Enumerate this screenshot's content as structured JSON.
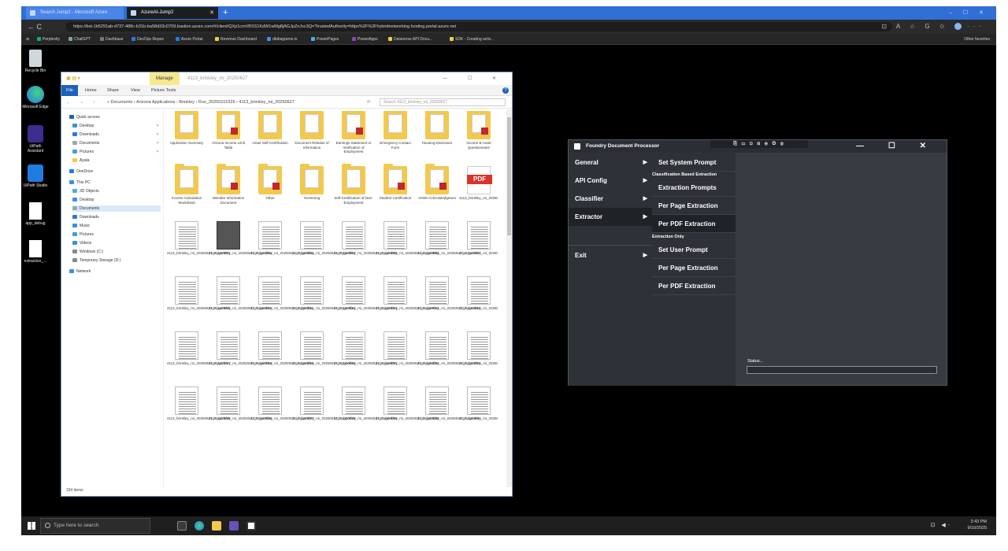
{
  "browser": {
    "tabs": [
      {
        "label": "Search Jump2 - Microsoft Azure"
      },
      {
        "label": "AzureAI-Jump2"
      }
    ],
    "new_tab": "+",
    "window_controls": "– ☐ ✕",
    "nav_buttons": "←  C",
    "url": "https://bst-1b5291ab-d737-488c-b31b-ba58d33c0709.bastion.azure.com/#/client/QXp1cmVBSS1KdW1wMg8jAGJpZnJvc3Q=?trustedAuthority=https%2F%2Fhybridnetworking.hosting.portal.azure.net",
    "actions": "⊡ A ☆ G ✩",
    "more": "···",
    "favorites": [
      "Perplexity",
      "ChatGPT",
      "Dashbase",
      "DevOps Repos",
      "Azure Portal",
      "Revenue Dashboard",
      "dbdiagrams.io",
      "PowerPages",
      "PowerApps",
      "Dataverse API Docu...",
      "SDK - Creating activ..."
    ],
    "other_favorites": "Other favorites"
  },
  "desktop": {
    "icons": [
      {
        "label": "Recycle Bin"
      },
      {
        "label": "Microsoft Edge"
      },
      {
        "label": "UiPath Assistant"
      },
      {
        "label": "UiPath Studio"
      },
      {
        "label": "app_debug"
      },
      {
        "label": "extraction_..."
      }
    ]
  },
  "explorer": {
    "title_manage": "Manage",
    "title_path": "4113_brinkley_mi_20250627",
    "window_controls": "—  ☐  ✕",
    "ribbon": [
      "File",
      "Home",
      "Share",
      "View",
      "Picture Tools"
    ],
    "help": "?",
    "nav_arrows": "← → ↑",
    "breadcrumb": "« Documents › Arizona Applications › Brinkley › Run_20250101526 › 4113_brinkley_mi_20250627",
    "refresh": "⟳",
    "search_placeholder": "Search 4113_brinkley_mi_20250627",
    "nav_items": [
      {
        "label": "Quick access",
        "color": "#1b63b8"
      },
      {
        "label": "Desktop",
        "color": "#3d8fe0"
      },
      {
        "label": "Downloads",
        "color": "#2a7ad8"
      },
      {
        "label": "Documents",
        "color": "#9aa"
      },
      {
        "label": "Pictures",
        "color": "#4a9ad8"
      },
      {
        "label": "Ayala",
        "color": "#f2c94c"
      },
      {
        "label": "OneDrive",
        "color": "#1f7de0"
      },
      {
        "label": "This PC",
        "color": "#3d8fe0"
      },
      {
        "label": "3D Objects",
        "color": "#4ab0e0"
      },
      {
        "label": "Desktop",
        "color": "#3d8fe0"
      },
      {
        "label": "Documents",
        "color": "#9aa"
      },
      {
        "label": "Downloads",
        "color": "#2a7ad8"
      },
      {
        "label": "Music",
        "color": "#3d8fe0"
      },
      {
        "label": "Pictures",
        "color": "#4a9ad8"
      },
      {
        "label": "Videos",
        "color": "#3d8fe0"
      },
      {
        "label": "Windows (C:)",
        "color": "#888"
      },
      {
        "label": "Temporary Storage (D:)",
        "color": "#888"
      },
      {
        "label": "Network",
        "color": "#3d8fe0"
      }
    ],
    "pin_mark": "✶",
    "folders": [
      "Application Summary",
      "Arizona Income Limit Table",
      "Asset Self-Certification",
      "Document Release of Information",
      "Earnings Statement or Verification of Employment",
      "Emergency Contact Form",
      "Housing Disclosure",
      "Income & Asset Questionnaire",
      "Income Calculation Worksheet",
      "Member Information Document",
      "Other",
      "Screening",
      "Self-Certification of Non-Employment",
      "Student Certification",
      "VAWA Acknowledgment"
    ],
    "pdf_label": "PDF",
    "pdf_file": "4113_brinkley_mi_20250627",
    "pages": [
      "4113_brinkley_mi_20250627_Page0001",
      "4113_brinkley_mi_20250627_Page0002",
      "4113_brinkley_mi_20250627_Page0003",
      "4113_brinkley_mi_20250627_Page0004",
      "4113_brinkley_mi_20250627_Page0005",
      "4113_brinkley_mi_20250627_Page0006",
      "4113_brinkley_mi_20250627_Page0007",
      "4113_brinkley_mi_20250627_Page0008",
      "4113_brinkley_mi_20250627_Page0009",
      "4113_brinkley_mi_20250627_Page0010",
      "4113_brinkley_mi_20250627_Page0011",
      "4113_brinkley_mi_20250627_Page0012",
      "4113_brinkley_mi_20250627_Page0013",
      "4113_brinkley_mi_20250627_Page0014",
      "4113_brinkley_mi_20250627_Page0015",
      "4113_brinkley_mi_20250627_Page0016",
      "4113_brinkley_mi_20250627_Page0017",
      "4113_brinkley_mi_20250627_Page0018",
      "4113_brinkley_mi_20250627_Page0019",
      "4113_brinkley_mi_20250627_Page0020",
      "4113_brinkley_mi_20250627_Page0021",
      "4113_brinkley_mi_20250627_Page0022",
      "4113_brinkley_mi_20250627_Page0023",
      "4113_brinkley_mi_20250627_Page0024",
      "4113_brinkley_mi_20250627_Page0025",
      "4113_brinkley_mi_20250627_Page0026",
      "4113_brinkley_mi_20250627_Page0027",
      "4113_brinkley_mi_20250627_Page0028",
      "4113_brinkley_mi_20250627_Page0029",
      "4113_brinkley_mi_20250627_Page0030",
      "4113_brinkley_mi_20250627_Page0031",
      "4113_brinkley_mi_20250627_Page0032"
    ],
    "status": "154 items"
  },
  "foundry": {
    "title": "Foundry Document Processor",
    "toolbar": "⎘ ▭ ⊡ ⊟ ⊕ ◎ ⊗",
    "window_controls": "— ☐ ✕",
    "menu": [
      {
        "label": "General"
      },
      {
        "label": "API Config"
      },
      {
        "label": "Classifier"
      },
      {
        "label": "Extractor"
      },
      {
        "label": "Exit"
      }
    ],
    "arrow": "▶",
    "submenu": {
      "set_system_prompt": "Set System Prompt",
      "heading_classification": "Classification Based Extraction",
      "extraction_prompts": "Extraction Prompts",
      "per_page_extraction_1": "Per Page Extraction",
      "per_pdf_extraction_1": "Per PDF Extraction",
      "heading_extraction_only": "Extraction Only",
      "set_user_prompt": "Set User Prompt",
      "per_page_extraction_2": "Per Page Extraction",
      "per_pdf_extraction_2": "Per PDF Extraction"
    },
    "status_label": "Status..."
  },
  "taskbar": {
    "search_placeholder": "Type here to search",
    "time": "3:43 PM",
    "date": "9/10/2025",
    "tray_icons": "⊡ ◀⋅"
  },
  "colors": {
    "browser_tab": "#2f6fd6",
    "foundry_bg": "#373c43",
    "foundry_menu": "#2e3238",
    "folder": "#f2c94c",
    "pdf_red": "#d9342b"
  }
}
